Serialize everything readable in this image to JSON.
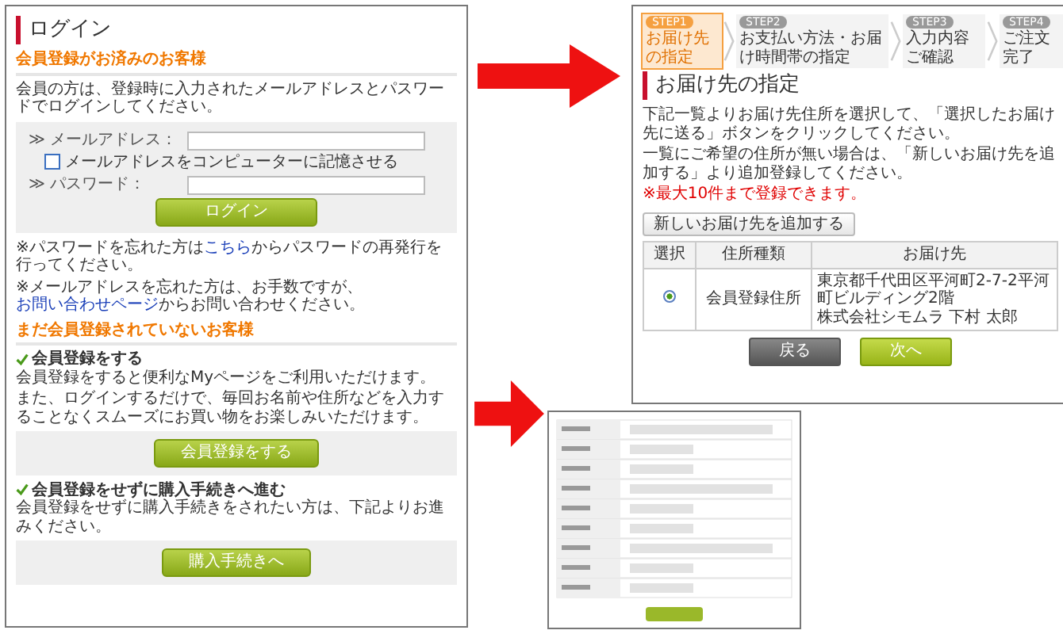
{
  "login_page": {
    "title": "ログイン",
    "member_section": {
      "heading": "会員登録がお済みのお客様",
      "intro": "会員の方は、登録時に入力されたメールアドレスとパスワードでログインしてください。",
      "form": {
        "email_label": "≫ メールアドレス：",
        "remember_label": "メールアドレスをコンピューターに記憶させる",
        "remember_checked": false,
        "password_label": "≫ パスワード：",
        "login_button": "ログイン"
      },
      "notes": [
        {
          "before": "※パスワードを忘れた方は",
          "link": "こちら",
          "after": "からパスワードの再発行を行ってください。"
        },
        {
          "before": "※メールアドレスを忘れた方は、お手数ですが、",
          "link": "お問い合わせページ",
          "after": "からお問い合わせください。"
        }
      ]
    },
    "guest_section": {
      "heading": "まだ会員登録されていないお客様",
      "options": [
        {
          "heading": "会員登録をする",
          "lines": [
            "会員登録をすると便利なMyページをご利用いただけます。",
            "また、ログインするだけで、毎回お名前や住所などを入力することなくスムーズにお買い物をお楽しみいただけます。"
          ],
          "button": "会員登録をする"
        },
        {
          "heading": "会員登録をせずに購入手続きへ進む",
          "lines": [
            "会員登録をせずに購入手続きをされたい方は、下記よりお進みください。"
          ],
          "button": "購入手続きへ"
        }
      ]
    }
  },
  "delivery_page": {
    "steps": [
      {
        "badge": "STEP1",
        "label": "お届け先の指定",
        "selected": true
      },
      {
        "badge": "STEP2",
        "label": "お支払い方法・お届け時間帯の指定",
        "selected": false
      },
      {
        "badge": "STEP3",
        "label": "入力内容ご確認",
        "selected": false
      },
      {
        "badge": "STEP4",
        "label": "ご注文完了",
        "selected": false
      }
    ],
    "title": "お届け先の指定",
    "instructions": [
      "下記一覧よりお届け先住所を選択して、「選択したお届け先に送る」ボタンをクリックしてください。",
      "一覧にご希望の住所が無い場合は、「新しいお届け先を追加する」より追加登録してください。"
    ],
    "note": "※最大10件まで登録できます。",
    "add_button": "新しいお届け先を追加する",
    "table": {
      "columns": [
        "選択",
        "住所種類",
        "お届け先"
      ],
      "rows": [
        {
          "selected": true,
          "type": "会員登録住所",
          "address_lines": [
            "東京都千代田区平河町2-7-2平河町ビルディング2階",
            "株式会社シモムラ 下村 太郎"
          ]
        }
      ]
    },
    "buttons": [
      {
        "label": "戻る",
        "kind": "back"
      },
      {
        "label": "次へ",
        "kind": "next"
      }
    ]
  }
}
